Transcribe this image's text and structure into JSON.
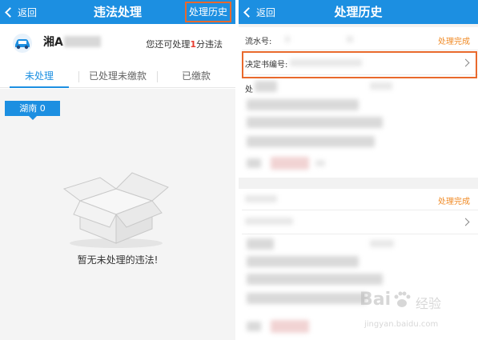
{
  "left": {
    "header": {
      "back_label": "返回",
      "title": "违法处理",
      "history_button": "处理历史"
    },
    "vehicle": {
      "plate_prefix": "湘A",
      "remaining_text_before": "您还可处理",
      "remaining_count": "1",
      "remaining_text_after": "分违法"
    },
    "tabs": [
      {
        "label": "未处理",
        "active": true
      },
      {
        "label": "已处理未缴款",
        "active": false
      },
      {
        "label": "已缴款",
        "active": false
      }
    ],
    "region_badge": "湖南 0",
    "empty_message": "暂无未处理的违法!"
  },
  "right": {
    "header": {
      "back_label": "返回",
      "title": "处理历史"
    },
    "record1": {
      "serial_label": "流水号:",
      "status": "处理完成",
      "decision_label": "决定书编号:",
      "process_label": "处"
    },
    "record2": {
      "status": "处理完成"
    }
  },
  "watermark": {
    "logo": "Bai",
    "suffix": "经验",
    "url": "jingyan.baidu.com"
  },
  "colors": {
    "header_blue": "#1c8fe1",
    "highlight_orange": "#e9692c",
    "status_orange": "#f08a24",
    "alert_red": "#e63b2e"
  }
}
